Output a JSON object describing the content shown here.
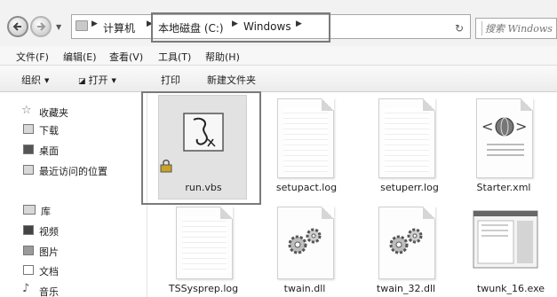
{
  "address_bar": {
    "crumbs": [
      "计算机",
      "本地磁盘 (C:)",
      "Windows"
    ],
    "search_placeholder": "搜索 Windows"
  },
  "menu": [
    {
      "label": "文件(F)"
    },
    {
      "label": "编辑(E)"
    },
    {
      "label": "查看(V)"
    },
    {
      "label": "工具(T)"
    },
    {
      "label": "帮助(H)"
    }
  ],
  "toolbar": {
    "organize": "组织",
    "open": "打开",
    "print": "打印",
    "new_folder": "新建文件夹"
  },
  "sidebar": {
    "favorites": "收藏夹",
    "downloads": "下载",
    "desktop": "桌面",
    "recent": "最近访问的位置",
    "libraries": "库",
    "videos": "视频",
    "pictures": "图片",
    "documents": "文档",
    "music": "音乐"
  },
  "files": [
    {
      "name": "run.vbs",
      "icon": "vbs-script-icon",
      "selected": true
    },
    {
      "name": "setupact.log",
      "icon": "text-document-icon"
    },
    {
      "name": "setuperr.log",
      "icon": "text-document-icon"
    },
    {
      "name": "Starter.xml",
      "icon": "xml-document-icon"
    },
    {
      "name": "TSSysprep.log",
      "icon": "text-document-icon"
    },
    {
      "name": "twain.dll",
      "icon": "dll-gears-icon"
    },
    {
      "name": "twain_32.dll",
      "icon": "dll-gears-icon"
    },
    {
      "name": "twunk_16.exe",
      "icon": "exe-window-icon"
    }
  ]
}
